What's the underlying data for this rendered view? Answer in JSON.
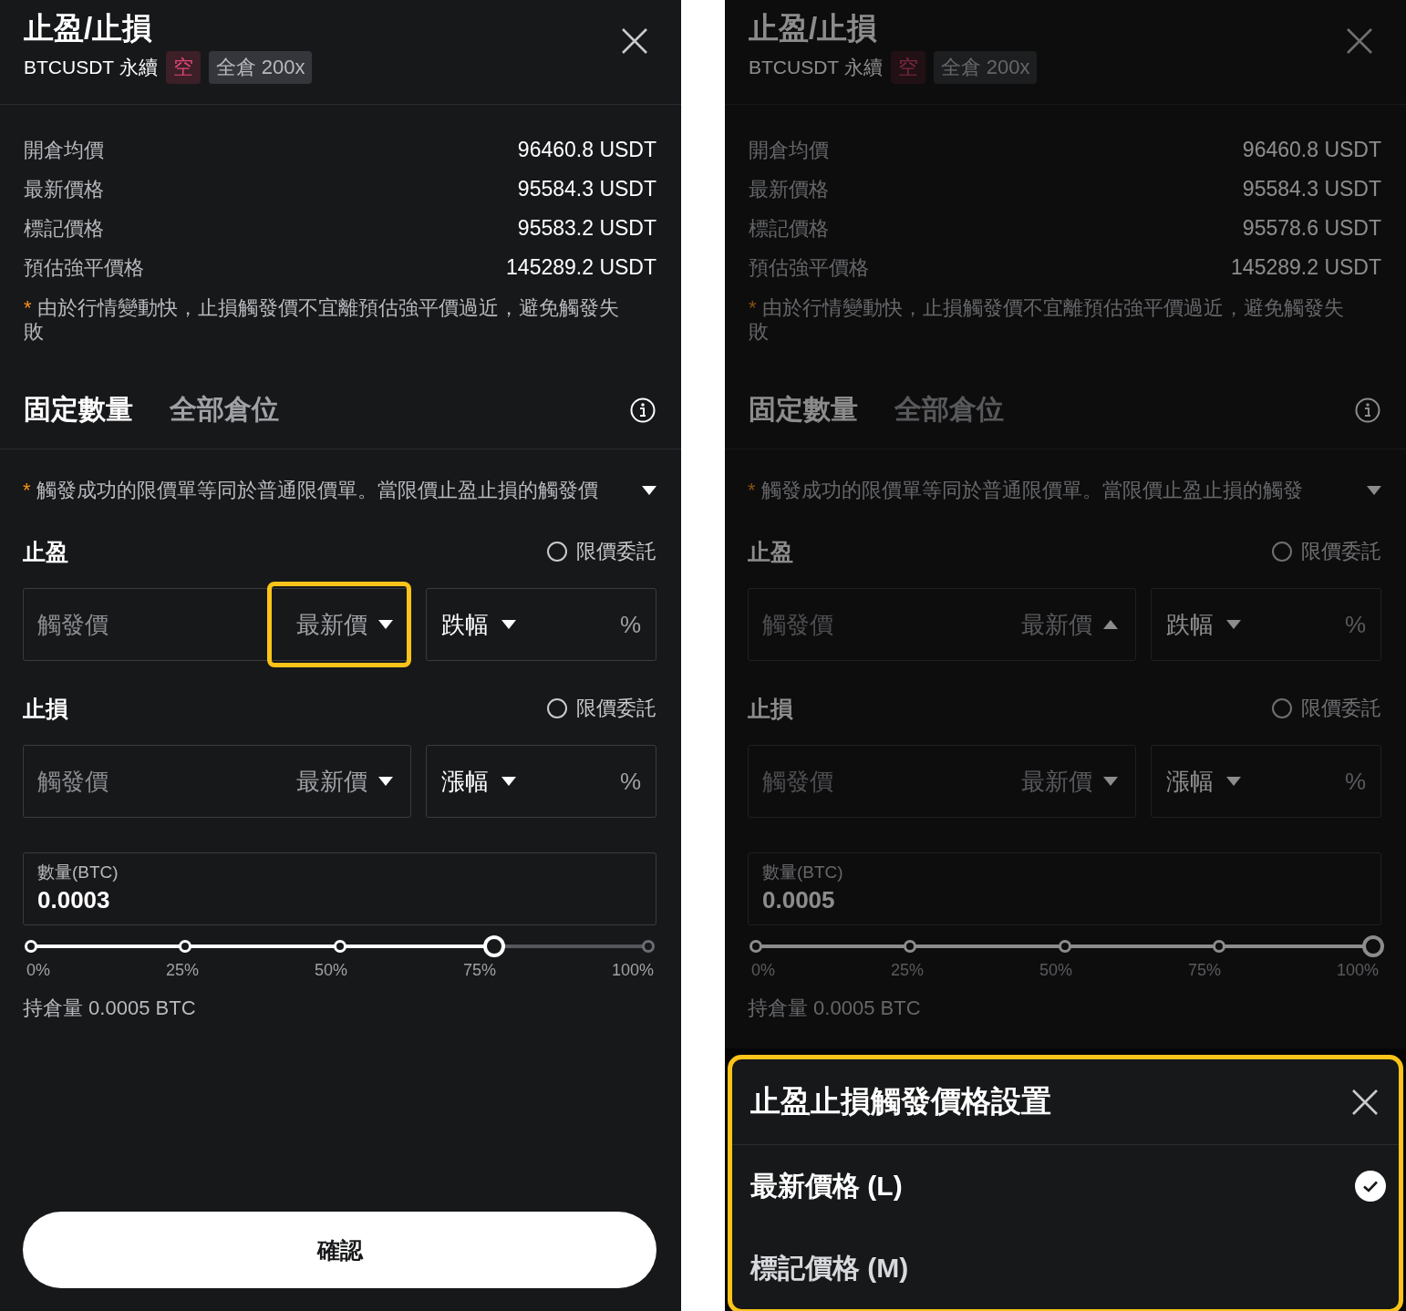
{
  "screens": [
    {
      "dimmed": false,
      "header": {
        "title": "止盈/止損",
        "symbol": "BTCUSDT 永續",
        "side_tag": "空",
        "margin_tag": "全倉 200x"
      },
      "info_rows": [
        {
          "label": "開倉均價",
          "value": "96460.8 USDT"
        },
        {
          "label": "最新價格",
          "value": "95584.3 USDT"
        },
        {
          "label": "標記價格",
          "value": "95583.2 USDT"
        },
        {
          "label": "預估強平價格",
          "value": "145289.2 USDT"
        }
      ],
      "warning": {
        "mark": "*",
        "text": "由於行情變動快，止損觸發價不宜離預估強平價過近，避免觸發失敗"
      },
      "tabs": [
        {
          "label": "固定數量",
          "selected": true
        },
        {
          "label": "全部倉位",
          "selected": false
        }
      ],
      "notice": {
        "mark": "*",
        "text": "觸發成功的限價單等同於普通限價單。當限價止盈止損的觸發價"
      },
      "sections": [
        {
          "title": "止盈",
          "limit_order": {
            "label": "限價委託",
            "checked": false
          },
          "trigger": {
            "placeholder": "觸發價",
            "source": "最新價",
            "expanded": false,
            "highlighted": true
          },
          "mode": {
            "label": "跌幅",
            "unit": "%"
          }
        },
        {
          "title": "止損",
          "limit_order": {
            "label": "限價委託",
            "checked": false
          },
          "trigger": {
            "placeholder": "觸發價",
            "source": "最新價",
            "expanded": false,
            "highlighted": false
          },
          "mode": {
            "label": "漲幅",
            "unit": "%"
          }
        }
      ],
      "quantity": {
        "label": "數量(BTC)",
        "value": "0.0003"
      },
      "slider": {
        "level": 0.75,
        "ticks": [
          "0%",
          "25%",
          "50%",
          "75%",
          "100%"
        ]
      },
      "position": "持倉量 0.0005 BTC",
      "confirm": "確認"
    },
    {
      "dimmed": true,
      "header": {
        "title": "止盈/止損",
        "symbol": "BTCUSDT 永續",
        "side_tag": "空",
        "margin_tag": "全倉 200x"
      },
      "info_rows": [
        {
          "label": "開倉均價",
          "value": "96460.8 USDT"
        },
        {
          "label": "最新價格",
          "value": "95584.3 USDT"
        },
        {
          "label": "標記價格",
          "value": "95578.6 USDT"
        },
        {
          "label": "預估強平價格",
          "value": "145289.2 USDT"
        }
      ],
      "warning": {
        "mark": "*",
        "text": "由於行情變動快，止損觸發價不宜離預估強平價過近，避免觸發失敗"
      },
      "tabs": [
        {
          "label": "固定數量",
          "selected": true
        },
        {
          "label": "全部倉位",
          "selected": false
        }
      ],
      "notice": {
        "mark": "*",
        "text": "觸發成功的限價單等同於普通限價單。當限價止盈止損的觸發"
      },
      "sections": [
        {
          "title": "止盈",
          "limit_order": {
            "label": "限價委託",
            "checked": false
          },
          "trigger": {
            "placeholder": "觸發價",
            "source": "最新價",
            "expanded": true,
            "highlighted": false
          },
          "mode": {
            "label": "跌幅",
            "unit": "%"
          }
        },
        {
          "title": "止損",
          "limit_order": {
            "label": "限價委託",
            "checked": false
          },
          "trigger": {
            "placeholder": "觸發價",
            "source": "最新價",
            "expanded": false,
            "highlighted": false
          },
          "mode": {
            "label": "漲幅",
            "unit": "%"
          }
        }
      ],
      "quantity": {
        "label": "數量(BTC)",
        "value": "0.0005"
      },
      "slider": {
        "level": 1,
        "ticks": [
          "0%",
          "25%",
          "50%",
          "75%",
          "100%"
        ]
      },
      "position": "持倉量 0.0005 BTC",
      "sheet": {
        "title": "止盈止損觸發價格設置",
        "highlighted": true,
        "options": [
          {
            "label": "最新價格 (L)",
            "selected": true
          },
          {
            "label": "標記價格 (M)",
            "selected": false
          }
        ]
      }
    }
  ]
}
